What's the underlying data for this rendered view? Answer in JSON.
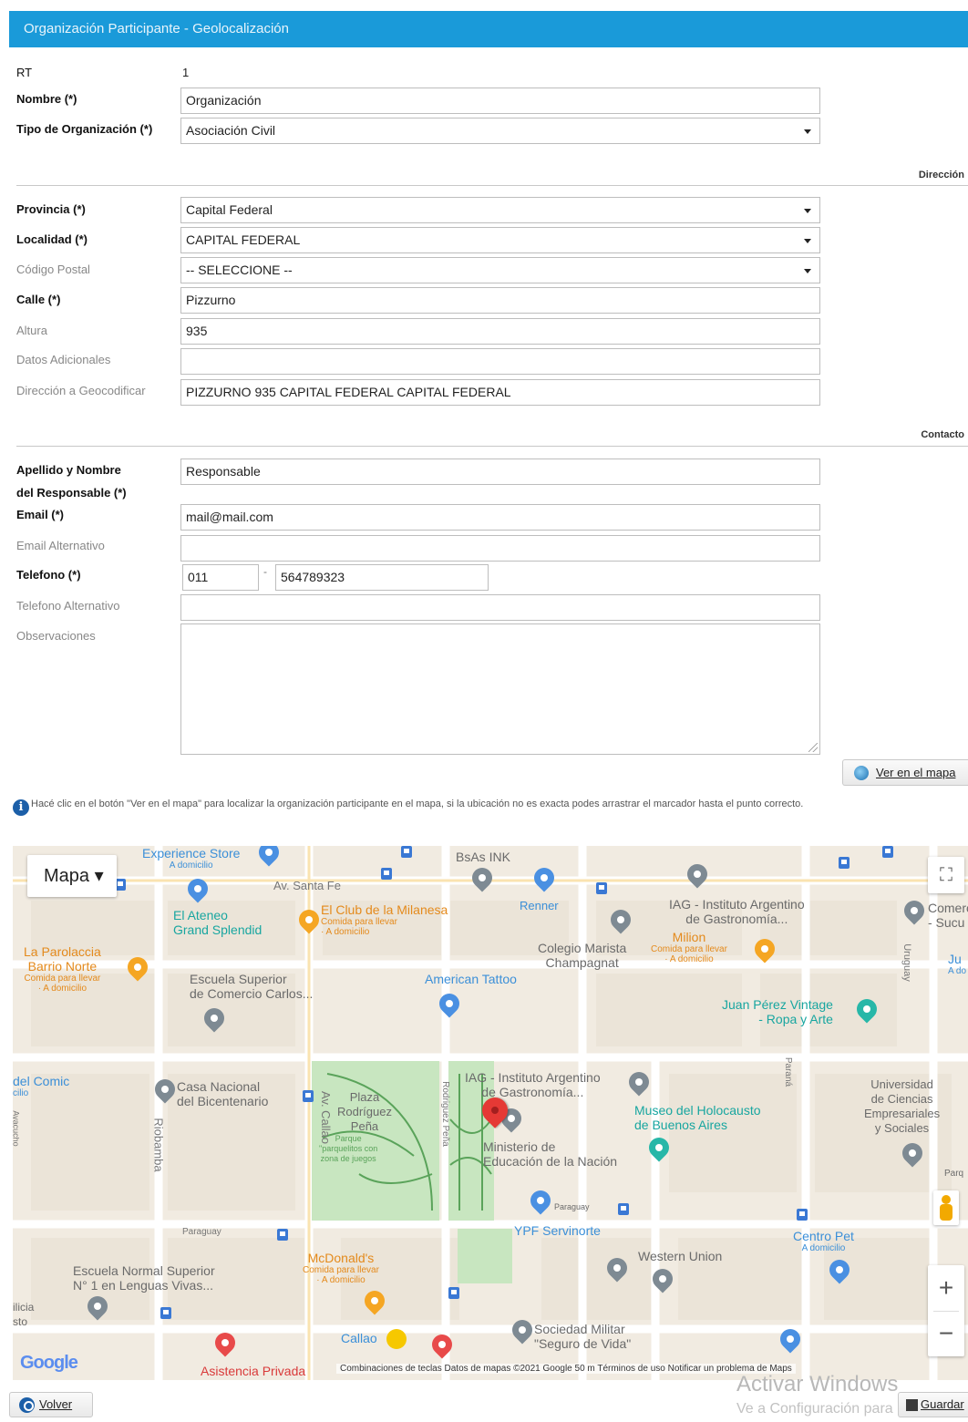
{
  "header": {
    "title": "Organización Participante - Geolocalización"
  },
  "form": {
    "rt": {
      "label": "RT",
      "value": "1"
    },
    "nombre": {
      "label": "Nombre (*)",
      "value": "Organización"
    },
    "tipo": {
      "label": "Tipo de Organización (*)",
      "value": "Asociación Civil"
    }
  },
  "direccion": {
    "section_title": "Dirección",
    "provincia": {
      "label": "Provincia (*)",
      "value": "Capital Federal"
    },
    "localidad": {
      "label": "Localidad (*)",
      "value": "CAPITAL FEDERAL"
    },
    "codigo_postal": {
      "label": "Código Postal",
      "value": "-- SELECCIONE --"
    },
    "calle": {
      "label": "Calle (*)",
      "value": "Pizzurno"
    },
    "altura": {
      "label": "Altura",
      "value": "935"
    },
    "datos_adicionales": {
      "label": "Datos Adicionales",
      "value": ""
    },
    "geocodificar": {
      "label": "Dirección a Geocodificar",
      "value": "PIZZURNO 935 CAPITAL FEDERAL CAPITAL FEDERAL"
    }
  },
  "contacto": {
    "section_title": "Contacto",
    "responsable": {
      "label_1": "Apellido y Nombre",
      "label_2": "del Responsable (*)",
      "value": "Responsable"
    },
    "email": {
      "label": "Email (*)",
      "value": "mail@mail.com"
    },
    "email_alt": {
      "label": "Email Alternativo",
      "value": ""
    },
    "telefono": {
      "label": "Telefono (*)",
      "area": "011",
      "separator": "-",
      "number": "564789323"
    },
    "telefono_alt": {
      "label": "Telefono Alternativo",
      "value": ""
    },
    "observaciones": {
      "label": "Observaciones",
      "value": ""
    }
  },
  "buttons": {
    "ver_mapa": "Ver en el mapa",
    "volver": "Volver",
    "guardar": "Guardar"
  },
  "info_text": "Hacé clic en el botón \"Ver en el mapa\" para localizar la organización participante en el mapa, si la ubicación no es exacta podes arrastrar el marcador hasta el punto correcto.",
  "map": {
    "type_control": "Mapa",
    "google": "Google",
    "footer": "Combinaciones de teclas   Datos de mapas ©2021 Google   50 m   Términos de uso   Notificar un problema de Maps",
    "streets": {
      "santa_fe": "Av. Santa Fe",
      "callao": "Av. Callao",
      "rodriguez_pena": "Rodriguez Peña",
      "riobamba": "Riobamba",
      "paraguay": "Paraguay",
      "parana": "Paraná",
      "uruguay": "Uruguay",
      "ayacucho": "Ayacucho"
    },
    "places": {
      "experience": "Experience Store",
      "experience_sub": "A domicilio",
      "bsas": "BsAs INK",
      "renner": "Renner",
      "iag1": "IAG - Instituto Argentino",
      "iag1b": "de Gastronomía...",
      "ateneo": "El Ateneo",
      "ateneo_b": "Grand Splendid",
      "milanesa": "El Club de la Milanesa",
      "milanesa_sub": "Comida para llevar",
      "milanesa_sub2": "· A domicilio",
      "marista": "Colegio Marista",
      "marista_b": "Champagnat",
      "milion": "Milion",
      "milion_sub": "Comida para llevar",
      "milion_sub2": "· A domicilio",
      "parolaccia": "La Parolaccia",
      "parolaccia_b": "Barrio Norte",
      "parolaccia_sub": "Comida para llevar",
      "parolaccia_sub2": "· A domicilio",
      "escuela_com": "Escuela Superior",
      "escuela_com_b": "de Comercio Carlos...",
      "tattoo": "American Tattoo",
      "juan": "Juan Pérez Vintage",
      "juan_b": "- Ropa y Arte",
      "comic": "del Comic",
      "comic_sub": "cilio",
      "casa": "Casa Nacional",
      "casa_b": "del Bicentenario",
      "plaza": "Plaza",
      "plaza_b": "Rodríguez",
      "plaza_c": "Peña",
      "parque": "Parque",
      "parque_b": "\"parquelitos con",
      "parque_c": "zona de juegos",
      "iag2": "IAG - Instituto Argentino",
      "iag2b": "de Gastronomía...",
      "museo": "Museo del Holocausto",
      "museo_b": "de Buenos Aires",
      "universidad": "Universidad",
      "universidad_b": "de Ciencias",
      "universidad_c": "Empresariales",
      "universidad_d": "y Sociales",
      "ministerio": "Ministerio de",
      "ministerio_b": "Educación de la Nación",
      "ypf": "YPF Servinorte",
      "paraguay_label": "Paraguay",
      "centro_pet": "Centro Pet",
      "centro_pet_sub": "A domicilio",
      "mcdonalds": "McDonald's",
      "mcdonalds_sub": "Comida para llevar",
      "mcdonalds_sub2": "· A domicilio",
      "escuela_normal": "Escuela Normal Superior",
      "escuela_normal_b": "N° 1 en Lenguas Vivas...",
      "western": "Western Union",
      "sociedad": "Sociedad Militar",
      "sociedad_b": "\"Seguro de Vida\"",
      "callao_st": "Callao",
      "asistencia": "Asistencia Privada",
      "comercio": "Comercio",
      "comercio_b": "- Sucu",
      "ju": "Ju",
      "ju_sub": "A do",
      "parq": "Parq",
      "ilicia": "ilicia",
      "ilicia_b": "sto"
    }
  },
  "watermark": {
    "line1": "Activar Windows",
    "line2": "Ve a Configuración para"
  }
}
